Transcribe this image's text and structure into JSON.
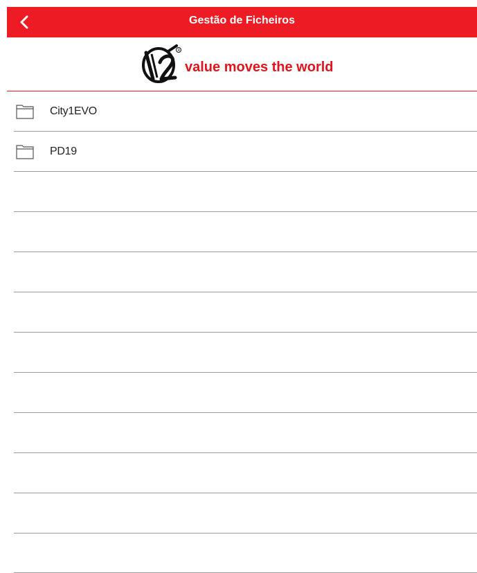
{
  "header": {
    "title": "Gestão de Ficheiros",
    "back_icon": "chevron-left-icon",
    "background_color": "#ed1c24"
  },
  "logo": {
    "tagline": "value moves the world",
    "brand_color": "#e1141e"
  },
  "files": [
    {
      "name": "City1EVO",
      "icon": "folder-icon"
    },
    {
      "name": "PD19",
      "icon": "folder-icon"
    },
    {
      "name": ""
    },
    {
      "name": ""
    },
    {
      "name": ""
    },
    {
      "name": ""
    },
    {
      "name": ""
    },
    {
      "name": ""
    },
    {
      "name": ""
    },
    {
      "name": ""
    },
    {
      "name": ""
    },
    {
      "name": ""
    }
  ]
}
